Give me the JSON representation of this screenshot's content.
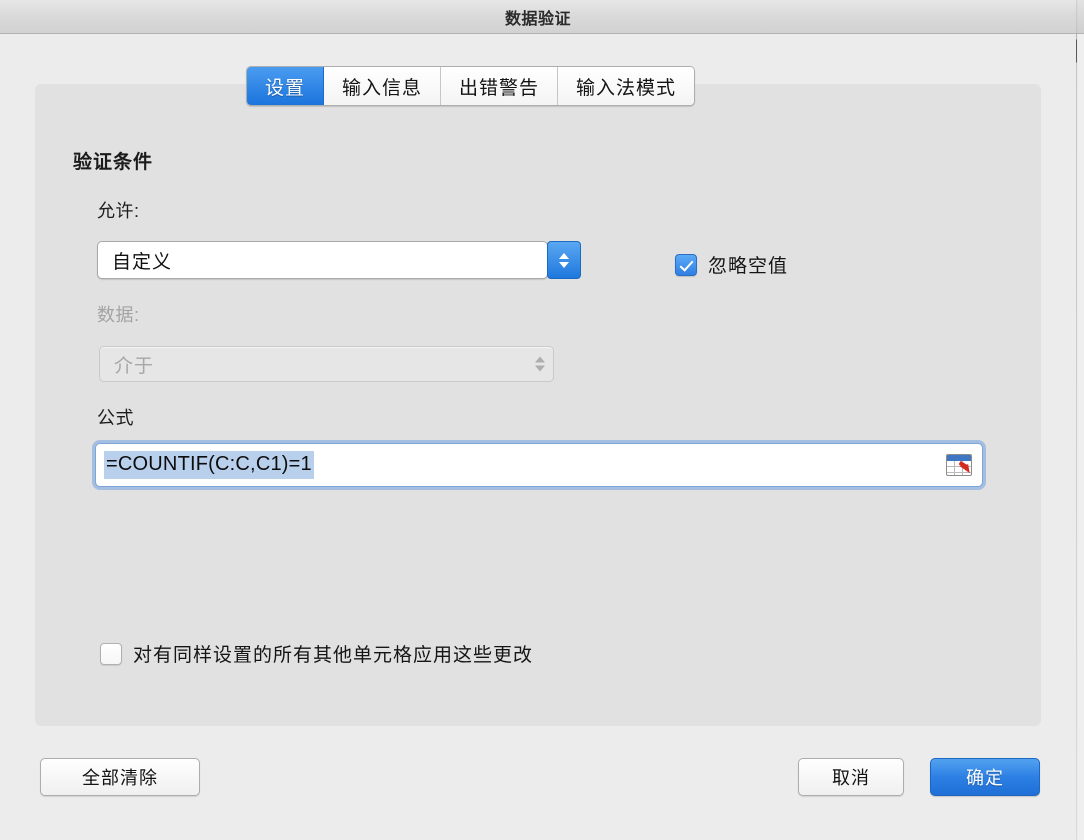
{
  "window": {
    "title": "数据验证"
  },
  "tabs": [
    {
      "label": "设置",
      "active": true
    },
    {
      "label": "输入信息",
      "active": false
    },
    {
      "label": "出错警告",
      "active": false
    },
    {
      "label": "输入法模式",
      "active": false
    }
  ],
  "settings": {
    "section_title": "验证条件",
    "allow": {
      "label": "允许:",
      "value": "自定义",
      "enabled": true,
      "stepper_icon": "stepper-up-down-icon"
    },
    "data": {
      "label": "数据:",
      "value": "介于",
      "enabled": false,
      "stepper_icon": "stepper-up-down-icon"
    },
    "formula": {
      "label": "公式",
      "value": "=COUNTIF(C:C,C1)=1",
      "selected": true,
      "focused": true,
      "range_picker_icon": "range-select-icon"
    },
    "ignore_blank": {
      "label": "忽略空值",
      "checked": true
    },
    "apply_to_all": {
      "label": "对有同样设置的所有其他单元格应用这些更改",
      "checked": false
    }
  },
  "buttons": {
    "clear_all": "全部清除",
    "cancel": "取消",
    "ok": "确定"
  },
  "colors": {
    "accent": "#2c7fe3",
    "active_tab": "#2a83e8",
    "window_bg": "#ececec",
    "panel_bg": "#e1e1e1",
    "selection": "#b9d0ec",
    "focus_ring": "#7fa6d8",
    "disabled_text": "#a7a7a7"
  }
}
